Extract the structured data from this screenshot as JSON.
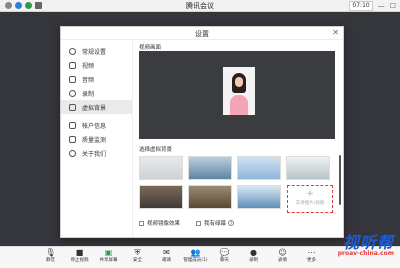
{
  "window": {
    "title": "腾讯会议",
    "time": "07:10",
    "controls": [
      "—",
      "☐"
    ]
  },
  "modal": {
    "title": "设置",
    "close": "✕",
    "sidebar": [
      {
        "label": "常规设置",
        "icon": "gear-icon"
      },
      {
        "label": "视频",
        "icon": "camera-icon"
      },
      {
        "label": "音频",
        "icon": "speaker-icon"
      },
      {
        "label": "录制",
        "icon": "record-icon"
      },
      {
        "label": "虚拟背景",
        "icon": "virtual-bg-icon",
        "active": true
      },
      {
        "label": "帐户信息",
        "icon": "account-icon"
      },
      {
        "label": "质量监测",
        "icon": "quality-icon"
      },
      {
        "label": "关于我们",
        "icon": "info-icon"
      }
    ],
    "preview_label": "视频画面",
    "bg_label": "选择虚拟背景",
    "add_tile": {
      "plus": "+",
      "label": "支持图片/视频"
    },
    "mirror_label": "视频镜像效果",
    "green_label": "我有绿幕",
    "help": "?"
  },
  "backgrounds": [
    {
      "name": "bg-white-room",
      "colors": [
        "#e8e9ea",
        "#cfd1d2"
      ]
    },
    {
      "name": "bg-sea",
      "colors": [
        "#b9cfdf",
        "#5f85a5"
      ]
    },
    {
      "name": "bg-sky-blue",
      "colors": [
        "#cfe3f2",
        "#8fb5d8"
      ]
    },
    {
      "name": "bg-window",
      "colors": [
        "#eef2f3",
        "#b8c4c8"
      ]
    },
    {
      "name": "bg-bookshelf",
      "colors": [
        "#7a6a5a",
        "#3f3a35"
      ]
    },
    {
      "name": "bg-library",
      "colors": [
        "#9a8a70",
        "#5a4a35"
      ]
    },
    {
      "name": "bg-ocean",
      "colors": [
        "#d9e8f3",
        "#5d8fb8"
      ]
    },
    {
      "name": "bg-horizon",
      "colors": [
        "#e5f0f8",
        "#2d6fb0"
      ]
    }
  ],
  "toolbar": [
    {
      "label": "静音",
      "icon": "mic-icon",
      "glyph": "🎙"
    },
    {
      "label": "停止视频",
      "icon": "video-icon",
      "glyph": "■"
    },
    {
      "label": "共享屏幕",
      "icon": "share-screen-icon",
      "glyph": "▣"
    },
    {
      "label": "安全",
      "icon": "security-icon",
      "glyph": "⛨"
    },
    {
      "label": "邀请",
      "icon": "invite-icon",
      "glyph": "✉"
    },
    {
      "label": "管理成员(1)",
      "icon": "members-icon",
      "glyph": "👥"
    },
    {
      "label": "聊天",
      "icon": "chat-icon",
      "glyph": "💬"
    },
    {
      "label": "录制",
      "icon": "record-icon",
      "glyph": "●"
    },
    {
      "label": "表情",
      "icon": "emoji-icon",
      "glyph": "☺"
    },
    {
      "label": "更多",
      "icon": "more-icon",
      "glyph": "⋯"
    }
  ],
  "watermark": {
    "big": "视听帮",
    "small": "proav-china.com"
  }
}
